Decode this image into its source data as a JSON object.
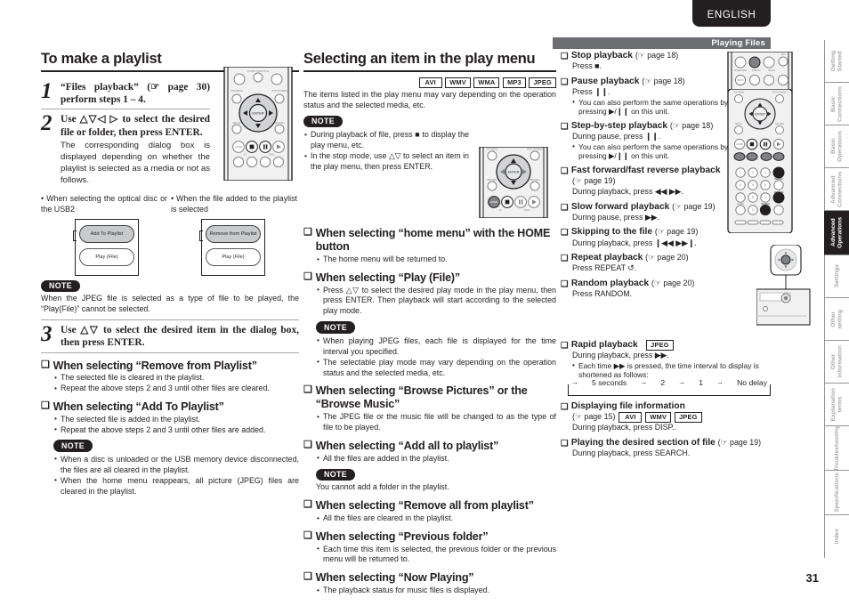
{
  "header": {
    "language_tab": "ENGLISH",
    "section_bar": "Playing Files"
  },
  "page_number": "31",
  "left_column": {
    "title": "To make a playlist",
    "steps": [
      {
        "num": "1",
        "main": "“Files playback” (☞ page 30) perform steps 1 – 4.",
        "sub": ""
      },
      {
        "num": "2",
        "main": "Use △▽◁ ▷ to select the desired file or folder, then press ENTER.",
        "sub": "The corresponding dialog box is displayed depending on whether the playlist is selected as a media or not as follows."
      },
      {
        "num": "3",
        "main": "Use △▽ to select the desired item in the dialog box, then press ENTER.",
        "sub": ""
      }
    ],
    "dialog_captions": [
      "• When selecting the optical disc or the USB2",
      "• When the file added to the playlist is selected"
    ],
    "dialog_left": {
      "selected": "Add To Playlist",
      "other": "Play (File)"
    },
    "dialog_right": {
      "selected": "Remove from Playlist",
      "other": "Play (File)"
    },
    "note1": {
      "label": "NOTE",
      "text": "When the JPEG file is selected as a type of file to be played, the “Play(File)” cannot be selected."
    },
    "sections": [
      {
        "heading": "When selecting “Remove from Playlist”",
        "bullets": [
          "The selected file is cleared in the playlist.",
          "Repeat the above steps 2 and 3 until other files are cleared."
        ]
      },
      {
        "heading": "When selecting “Add To Playlist”",
        "bullets": [
          "The selected file is added in the playlist.",
          "Repeat the above steps 2 and 3 until other files are added."
        ]
      }
    ],
    "note2": {
      "label": "NOTE",
      "bullets": [
        "When a disc is unloaded or the USB memory device disconnected, the files are all cleared in the playlist.",
        "When the home menu reappears, all picture (JPEG) files are cleared in the playlist."
      ]
    }
  },
  "mid_column": {
    "title": "Selecting an item in the play menu",
    "chips": [
      "AVI",
      "WMV",
      "WMA",
      "MP3",
      "JPEG"
    ],
    "intro": "The items listed in the play menu may vary depending on the operation status and the selected media, etc.",
    "note": {
      "label": "NOTE",
      "bullets": [
        "During playback of file, press ■ to display the play menu, etc.",
        "In the stop mode, use △▽ to select an item in the play menu, then press ENTER."
      ]
    },
    "sections": [
      {
        "heading": "When selecting “home menu” with the HOME button",
        "bullets": [
          "The home menu will be returned to."
        ]
      },
      {
        "heading": "When selecting “Play (File)”",
        "bullets": [
          "Press △▽ to select the desired play mode in the play menu, then press ENTER. Then playback will start according to the selected play mode."
        ]
      }
    ],
    "note2": {
      "label": "NOTE",
      "bullets": [
        "When playing JPEG files, each file is displayed for the time interval you specified.",
        "The selectable play mode may vary depending on the operation status and the selected media, etc."
      ]
    },
    "sections2": [
      {
        "heading": "When selecting “Browse Pictures” or the “Browse Music”",
        "bullets": [
          "The JPEG file or the music file will be changed to as the type of file to be played."
        ]
      },
      {
        "heading": "When selecting “Add all to playlist”",
        "bullets": [
          "All the files are added in the playlist."
        ]
      }
    ],
    "note3": {
      "label": "NOTE",
      "text": "You cannot add a folder in the playlist."
    },
    "sections3": [
      {
        "heading": "When selecting “Remove all from playlist”",
        "bullets": [
          "All the files are cleared in the playlist."
        ]
      },
      {
        "heading": "When selecting “Previous folder”",
        "bullets": [
          "Each time this item is selected, the previous folder or the previous menu will be returned to."
        ]
      },
      {
        "heading": "When selecting “Now Playing”",
        "bullets": [
          "The playback status for music files is displayed."
        ]
      }
    ]
  },
  "right_column": {
    "items": [
      {
        "heading": "Stop playback",
        "pageref": "(☞ page 18)",
        "sub": "Press ■.",
        "bullets": []
      },
      {
        "heading": "Pause playback",
        "pageref": "(☞ page 18)",
        "sub": "Press ❙❙.",
        "bullets": [
          "You can also perform the same operations by pressing ▶/❙❙ on this unit."
        ]
      },
      {
        "heading": "Step-by-step playback",
        "pageref": "(☞ page 18)",
        "sub": "During pause, press ❙❙.",
        "bullets": [
          "You can also perform the same operations by pressing ▶/❙❙ on this unit."
        ]
      },
      {
        "heading": "Fast forward/fast reverse playback",
        "pageref": "(☞ page 19)",
        "sub": "During playback, press ◀◀ ▶▶.",
        "bullets": []
      },
      {
        "heading": "Slow forward playback",
        "pageref": "(☞ page 19)",
        "sub": "During pause, press ▶▶.",
        "bullets": []
      },
      {
        "heading": "Skipping to the file",
        "pageref": "(☞ page 19)",
        "sub": "During playback, press ❙◀◀ ▶▶❙.",
        "bullets": []
      },
      {
        "heading": "Repeat playback",
        "pageref": "(☞ page 20)",
        "sub": "Press REPEAT ↺.",
        "bullets": []
      },
      {
        "heading": "Random playback",
        "pageref": "(☞ page 20)",
        "sub": "Press RANDOM.",
        "bullets": []
      }
    ],
    "rapid": {
      "heading": "Rapid playback",
      "chip": "JPEG",
      "sub": "During playback, press ▶▶.",
      "bullet": "Each time ▶▶ is pressed, the time interval to display is shortened as follows:",
      "flow": [
        "5 seconds",
        "2",
        "1",
        "No delay"
      ]
    },
    "fileinfo": {
      "heading": "Displaying file information",
      "pageref": "(☞ page 15)",
      "chips": [
        "AVI",
        "WMV",
        "JPEG"
      ],
      "sub": "During playback, press DISP.."
    },
    "section_play": {
      "heading": "Playing the desired section of file",
      "pageref": "(☞ page 19)",
      "sub": "During playback, press SEARCH."
    }
  },
  "sidebar_tabs": [
    {
      "label": "Getting\nStarted",
      "active": false
    },
    {
      "label": "Basic\nConnections",
      "active": false
    },
    {
      "label": "Basic\nOperations",
      "active": false
    },
    {
      "label": "Advanced\nConnections",
      "active": false
    },
    {
      "label": "Advanced\nOperations",
      "active": true
    },
    {
      "label": "Settings",
      "active": false
    },
    {
      "label": "Other\nsetting",
      "active": false
    },
    {
      "label": "Other\nInformation",
      "active": false
    },
    {
      "label": "Explanation\nterms",
      "active": false
    },
    {
      "label": "Troubleshooting",
      "active": false
    },
    {
      "label": "Specifications",
      "active": false
    },
    {
      "label": "Index",
      "active": false
    }
  ],
  "remote_labels": {
    "enter": "ENTER",
    "top_menu": "TOP MENU",
    "popup_menu": "POP UP MENU",
    "setup": "SETUP",
    "return": "RETURN",
    "home": "HOME"
  }
}
